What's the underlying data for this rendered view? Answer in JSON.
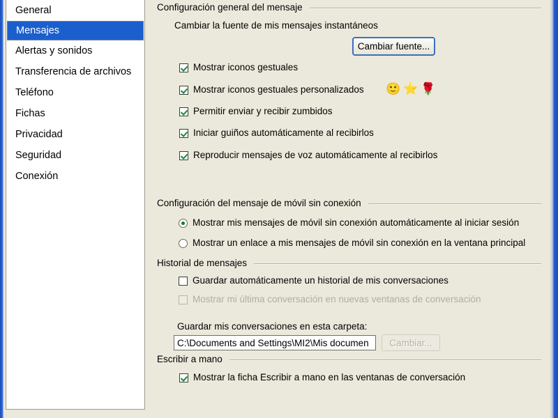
{
  "sidebar": {
    "items": [
      {
        "label": "General",
        "selected": false
      },
      {
        "label": "Mensajes",
        "selected": true
      },
      {
        "label": "Alertas y sonidos",
        "selected": false
      },
      {
        "label": "Transferencia de archivos",
        "selected": false
      },
      {
        "label": "Teléfono",
        "selected": false
      },
      {
        "label": "Fichas",
        "selected": false
      },
      {
        "label": "Privacidad",
        "selected": false
      },
      {
        "label": "Seguridad",
        "selected": false
      },
      {
        "label": "Conexión",
        "selected": false
      }
    ]
  },
  "groups": {
    "general": "Configuración general del mensaje",
    "mobile": "Configuración del mensaje de móvil sin conexión",
    "history": "Historial de mensajes",
    "handwriting": "Escribir a mano"
  },
  "general": {
    "font_label": "Cambiar la fuente de mis mensajes instantáneos",
    "font_button": "Cambiar fuente...",
    "checkboxes": [
      {
        "label": "Mostrar iconos gestuales",
        "checked": true
      },
      {
        "label": "Mostrar iconos gestuales personalizados",
        "checked": true
      },
      {
        "label": "Permitir enviar y recibir zumbidos",
        "checked": true
      },
      {
        "label": "Iniciar guiños automáticamente al recibirlos",
        "checked": true
      },
      {
        "label": "Reproducir mensajes de voz automáticamente al recibirlos",
        "checked": true
      }
    ],
    "emoticons": [
      {
        "name": "smiley-face-icon",
        "glyph": "🙂"
      },
      {
        "name": "star-icon",
        "glyph": "⭐"
      },
      {
        "name": "rose-flower-icon",
        "glyph": "🌹"
      }
    ]
  },
  "mobile": {
    "options": [
      {
        "label": "Mostrar mis mensajes de móvil sin conexión automáticamente al iniciar sesión",
        "selected": true
      },
      {
        "label": "Mostrar un enlace a mis mensajes de móvil sin conexión en la ventana principal",
        "selected": false
      }
    ]
  },
  "history": {
    "save_history": {
      "label": "Guardar automáticamente un historial de mis conversaciones",
      "checked": false,
      "disabled": false
    },
    "show_last": {
      "label": "Mostrar mi última conversación en nuevas ventanas de conversación",
      "checked": false,
      "disabled": true
    },
    "folder_label": "Guardar mis conversaciones en esta carpeta:",
    "folder_value": "C:\\Documents and Settings\\MI2\\Mis documen",
    "change_button": "Cambiar...",
    "change_button_disabled": true
  },
  "handwriting": {
    "checkbox": {
      "label": "Mostrar la ficha Escribir a mano en las ventanas de conversación",
      "checked": true
    }
  },
  "colors": {
    "selection_blue": "#1b5fce",
    "panel_bg": "#ebe9db",
    "window_frame_blue": "#2457cc",
    "check_green": "#13893c"
  }
}
